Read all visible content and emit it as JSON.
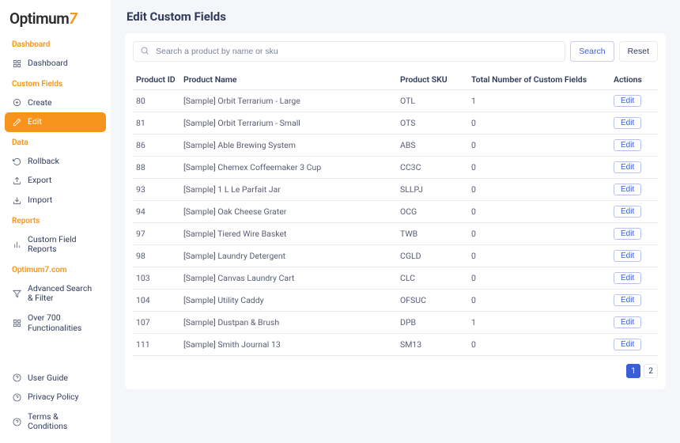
{
  "brand": {
    "name": "Optimum",
    "accent": "7"
  },
  "page": {
    "title": "Edit Custom Fields"
  },
  "search": {
    "placeholder": "Search a product by name or sku",
    "search_label": "Search",
    "reset_label": "Reset"
  },
  "sidebar": {
    "sections": [
      {
        "title": "Dashboard",
        "items": [
          {
            "label": "Dashboard",
            "icon": "grid-icon"
          }
        ]
      },
      {
        "title": "Custom Fields",
        "items": [
          {
            "label": "Create",
            "icon": "plus-circle-icon"
          },
          {
            "label": "Edit",
            "icon": "pencil-icon",
            "active": true
          }
        ]
      },
      {
        "title": "Data",
        "items": [
          {
            "label": "Rollback",
            "icon": "undo-icon"
          },
          {
            "label": "Export",
            "icon": "export-icon"
          },
          {
            "label": "Import",
            "icon": "import-icon"
          }
        ]
      },
      {
        "title": "Reports",
        "items": [
          {
            "label": "Custom Field Reports",
            "icon": "barchart-icon"
          }
        ]
      },
      {
        "title": "Optimum7.com",
        "items": [
          {
            "label": "Advanced Search & Filter",
            "icon": "filter-icon"
          },
          {
            "label": "Over 700 Functionalities",
            "icon": "apps-icon"
          }
        ]
      }
    ],
    "footer": [
      {
        "label": "User Guide",
        "icon": "help-icon"
      },
      {
        "label": "Privacy Policy",
        "icon": "help-icon"
      },
      {
        "label": "Terms & Conditions",
        "icon": "help-icon"
      }
    ]
  },
  "table": {
    "columns": [
      "Product ID",
      "Product Name",
      "Product SKU",
      "Total Number of Custom Fields",
      "Actions"
    ],
    "edit_label": "Edit",
    "rows": [
      {
        "id": "80",
        "name": "[Sample] Orbit Terrarium - Large",
        "sku": "OTL",
        "count": "1"
      },
      {
        "id": "81",
        "name": "[Sample] Orbit Terrarium - Small",
        "sku": "OTS",
        "count": "0"
      },
      {
        "id": "86",
        "name": "[Sample] Able Brewing System",
        "sku": "ABS",
        "count": "0"
      },
      {
        "id": "88",
        "name": "[Sample] Chemex Coffeemaker 3 Cup",
        "sku": "CC3C",
        "count": "0"
      },
      {
        "id": "93",
        "name": "[Sample] 1 L Le Parfait Jar",
        "sku": "SLLPJ",
        "count": "0"
      },
      {
        "id": "94",
        "name": "[Sample] Oak Cheese Grater",
        "sku": "OCG",
        "count": "0"
      },
      {
        "id": "97",
        "name": "[Sample] Tiered Wire Basket",
        "sku": "TWB",
        "count": "0"
      },
      {
        "id": "98",
        "name": "[Sample] Laundry Detergent",
        "sku": "CGLD",
        "count": "0"
      },
      {
        "id": "103",
        "name": "[Sample] Canvas Laundry Cart",
        "sku": "CLC",
        "count": "0"
      },
      {
        "id": "104",
        "name": "[Sample] Utility Caddy",
        "sku": "OFSUC",
        "count": "0"
      },
      {
        "id": "107",
        "name": "[Sample] Dustpan & Brush",
        "sku": "DPB",
        "count": "1"
      },
      {
        "id": "111",
        "name": "[Sample] Smith Journal 13",
        "sku": "SM13",
        "count": "0"
      }
    ]
  },
  "pagination": {
    "pages": [
      "1",
      "2"
    ],
    "active": 0
  }
}
